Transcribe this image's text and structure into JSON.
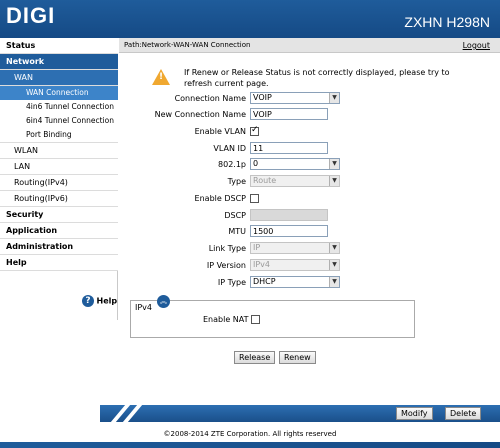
{
  "header": {
    "logo": "DIGI",
    "model": "ZXHN H298N"
  },
  "path": {
    "text": "Path:Network-WAN-WAN Connection",
    "logout": "Logout"
  },
  "nav": {
    "status": "Status",
    "network": "Network",
    "wan": "WAN",
    "wan_connection": "WAN Connection",
    "tunnel_4in6": "4in6 Tunnel Connection",
    "tunnel_6in4": "6in4 Tunnel Connection",
    "port_binding": "Port Binding",
    "wlan": "WLAN",
    "lan": "LAN",
    "routing_ipv4": "Routing(IPv4)",
    "routing_ipv6": "Routing(IPv6)",
    "security": "Security",
    "application": "Application",
    "administration": "Administration",
    "help": "Help",
    "help_button": "Help"
  },
  "notice": "If Renew or Release Status is not correctly displayed, please try to refresh current page.",
  "form": {
    "connection_name_label": "Connection Name",
    "connection_name_value": "VOIP",
    "new_connection_name_label": "New Connection Name",
    "new_connection_name_value": "VOIP",
    "enable_vlan_label": "Enable VLAN",
    "vlan_id_label": "VLAN ID",
    "vlan_id_value": "11",
    "dot1p_label": "802.1p",
    "dot1p_value": "0",
    "type_label": "Type",
    "type_value": "Route",
    "enable_dscp_label": "Enable DSCP",
    "dscp_label": "DSCP",
    "dscp_value": "",
    "mtu_label": "MTU",
    "mtu_value": "1500",
    "link_type_label": "Link Type",
    "link_type_value": "IP",
    "ip_version_label": "IP Version",
    "ip_version_value": "IPv4",
    "ip_type_label": "IP Type",
    "ip_type_value": "DHCP"
  },
  "ipv4": {
    "legend": "IPv4",
    "enable_nat_label": "Enable NAT"
  },
  "buttons": {
    "release": "Release",
    "renew": "Renew",
    "modify": "Modify",
    "delete": "Delete"
  },
  "footer": {
    "copyright": "©2008-2014 ZTE Corporation. All rights reserved"
  },
  "checkbox_state": {
    "enable_vlan": true,
    "enable_dscp": false,
    "enable_nat": false
  },
  "colors": {
    "brand_blue": "#1f5c9b",
    "warning": "#f0a830"
  }
}
